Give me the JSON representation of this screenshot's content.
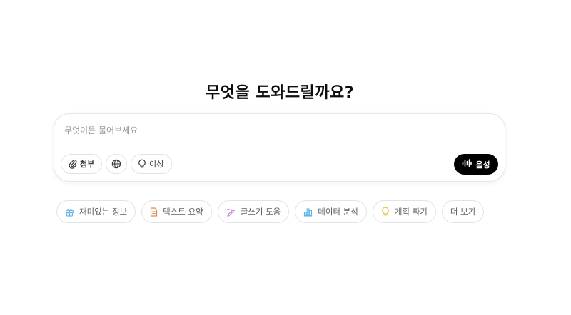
{
  "headline": "무엇을 도와드릴까요?",
  "composer": {
    "placeholder": "무엇이든 물어보세요",
    "value": "",
    "attach_label": "첨부",
    "web_icon": "globe-icon",
    "reason_label": "이성",
    "voice_label": "음성"
  },
  "suggestions": [
    {
      "label": "재미있는 정보",
      "icon": "gift-icon",
      "color": "#6bb7e8"
    },
    {
      "label": "텍스트 요약",
      "icon": "document-icon",
      "color": "#e0894a"
    },
    {
      "label": "글쓰기 도움",
      "icon": "pen-icon",
      "color": "#c77ad6"
    },
    {
      "label": "데이터 분석",
      "icon": "bar-chart-icon",
      "color": "#5fb3e6"
    },
    {
      "label": "계획 짜기",
      "icon": "lightbulb-icon",
      "color": "#e6c23a"
    },
    {
      "label": "더 보기",
      "icon": "",
      "color": ""
    }
  ],
  "colors": {
    "text": "#0d0d0d",
    "muted": "#5d5d5d",
    "border": "#e3e3e3",
    "voice_bg": "#000000"
  }
}
